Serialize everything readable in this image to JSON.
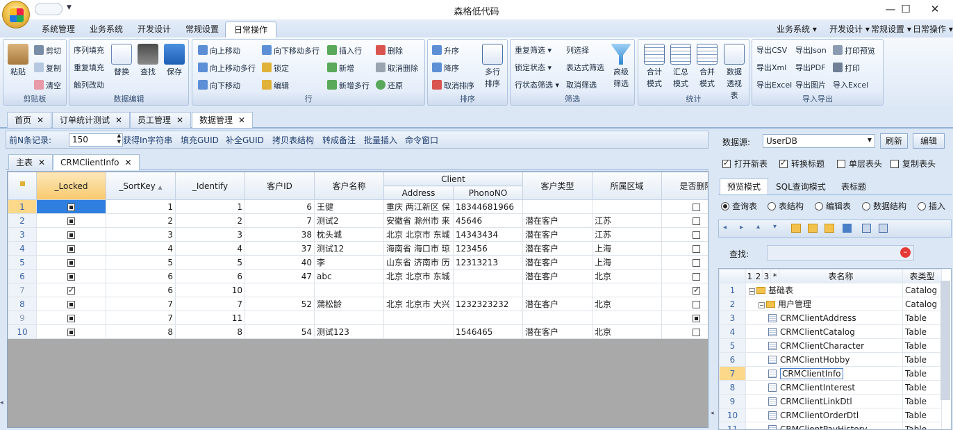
{
  "window": {
    "title": "森格低代码",
    "controls": [
      "—",
      "☐",
      "✕"
    ]
  },
  "ribbon_tabs": [
    "系统管理",
    "业务系统",
    "开发设计",
    "常规设置",
    "日常操作"
  ],
  "ribbon_menus": [
    "业务系统",
    "开发设计",
    "常规设置",
    "日常操作"
  ],
  "groups": {
    "clipboard": {
      "caption": "剪贴板",
      "paste": "粘贴",
      "cut": "剪切",
      "copy": "复制",
      "clear": "清空"
    },
    "dataedit": {
      "caption": "数据编辑",
      "seq_fill": "序列填充",
      "repeat_fill": "重复填充",
      "trigger_edit": "触列改动",
      "replace": "替换",
      "find": "查找",
      "save": "保存"
    },
    "row": {
      "caption": "行",
      "up": "向上移动",
      "up_multi": "向上移动多行",
      "down": "向下移动",
      "down_multi": "向下移动多行",
      "lock": "锁定",
      "edit": "编辑",
      "insert": "插入行",
      "new": "新增",
      "new_multi": "新增多行",
      "delete": "删除",
      "cancel_delete": "取消删除",
      "restore": "还原"
    },
    "sort": {
      "caption": "排序",
      "asc": "升序",
      "desc": "降序",
      "cancel": "取消排序",
      "multi": "多行排序"
    },
    "filter": {
      "caption": "筛选",
      "repeat": "重复筛选",
      "lock_state": "锁定状态",
      "row_state": "行状态筛选",
      "col_select": "列选择",
      "expr": "表达式筛选",
      "cancel": "取消筛选",
      "advanced": "高级筛选"
    },
    "stats": {
      "caption": "统计",
      "total": "合计模式",
      "summary": "汇总模式",
      "merge": "合并模式",
      "pivot": "数据透视表"
    },
    "io": {
      "caption": "导入导出",
      "csv": "导出CSV",
      "json": "导出Json",
      "print_preview": "打印预览",
      "xml": "导出Xml",
      "pdf": "导出PDF",
      "print": "打印",
      "excel": "导出Excel",
      "image": "导出图片",
      "import_excel": "导入Excel"
    }
  },
  "doc_tabs": [
    "首页",
    "订单统计测试",
    "员工管理",
    "数据管理"
  ],
  "toolbar": {
    "topn_label": "前N条记录:",
    "topn_value": "150",
    "links": [
      "获得In字符串",
      "填充GUID",
      "补全GUID",
      "拷贝表结构",
      "转成备注",
      "批量插入",
      "命令窗口"
    ]
  },
  "sub_tabs": [
    "主表",
    "CRMClientInfo"
  ],
  "grid": {
    "group_header": "Client",
    "headers": [
      "_Locked",
      "_SortKey",
      "_Identify",
      "客户ID",
      "客户名称",
      "Address",
      "PhonoNO",
      "客户类型",
      "所属区域",
      "是否删除"
    ],
    "rows": [
      {
        "n": "1",
        "locked": "fill",
        "sort": "1",
        "ident": "1",
        "id": "6",
        "name": "王健",
        "addr": "重庆 两江新区 保",
        "phone": "18344681966",
        "type": "",
        "region": "",
        "del": "box"
      },
      {
        "n": "2",
        "locked": "fill",
        "sort": "2",
        "ident": "2",
        "id": "7",
        "name": "测试2",
        "addr": "安徽省 滁州市 来",
        "phone": "45646",
        "type": "潜在客户",
        "region": "江苏",
        "del": "box"
      },
      {
        "n": "3",
        "locked": "fill",
        "sort": "3",
        "ident": "3",
        "id": "38",
        "name": "枕头城",
        "addr": "北京 北京市 东城",
        "phone": "14343434",
        "type": "潜在客户",
        "region": "江苏",
        "del": "box"
      },
      {
        "n": "4",
        "locked": "fill",
        "sort": "4",
        "ident": "4",
        "id": "37",
        "name": "测试12",
        "addr": "海南省 海口市 琼",
        "phone": "123456",
        "type": "潜在客户",
        "region": "上海",
        "del": "box"
      },
      {
        "n": "5",
        "locked": "fill",
        "sort": "5",
        "ident": "5",
        "id": "40",
        "name": "李",
        "addr": "山东省 济南市 历",
        "phone": "12313213",
        "type": "潜在客户",
        "region": "上海",
        "del": "box"
      },
      {
        "n": "6",
        "locked": "fill",
        "sort": "6",
        "ident": "6",
        "id": "47",
        "name": "abc",
        "addr": "北京 北京市 东城",
        "phone": "",
        "type": "潜在客户",
        "region": "北京",
        "del": "box"
      },
      {
        "n": "7",
        "locked": "tick",
        "sort": "6",
        "ident": "10",
        "id": "",
        "name": "",
        "addr": "",
        "phone": "",
        "type": "",
        "region": "",
        "del": "tick"
      },
      {
        "n": "8",
        "locked": "fill",
        "sort": "7",
        "ident": "7",
        "id": "52",
        "name": "蒲松龄",
        "addr": "北京 北京市 大兴",
        "phone": "1232323232",
        "type": "潜在客户",
        "region": "北京",
        "del": "box"
      },
      {
        "n": "9",
        "locked": "fill",
        "sort": "7",
        "ident": "11",
        "id": "",
        "name": "",
        "addr": "",
        "phone": "",
        "type": "",
        "region": "",
        "del": "fill"
      },
      {
        "n": "10",
        "locked": "fill",
        "sort": "8",
        "ident": "8",
        "id": "54",
        "name": "测试123",
        "addr": "",
        "phone": "1546465",
        "type": "潜在客户",
        "region": "北京",
        "del": "box"
      }
    ]
  },
  "right": {
    "datasource_label": "数据源:",
    "datasource_value": "UserDB",
    "refresh": "刷新",
    "edit": "编辑",
    "checks": [
      {
        "label": "打开新表",
        "on": true
      },
      {
        "label": "转换标题",
        "on": true
      },
      {
        "label": "单层表头",
        "on": false
      },
      {
        "label": "复制表头",
        "on": false
      }
    ],
    "tabs": [
      "预览模式",
      "SQL查询模式",
      "表标题"
    ],
    "radios": [
      {
        "label": "查询表",
        "on": true
      },
      {
        "label": "表结构",
        "on": false
      },
      {
        "label": "编辑表",
        "on": false
      },
      {
        "label": "数据结构",
        "on": false
      },
      {
        "label": "插入",
        "on": false
      }
    ],
    "find_label": "查找:",
    "tree_headers": [
      "1",
      "2",
      "3",
      "*",
      "表名称",
      "表类型"
    ],
    "tree_rows": [
      {
        "n": "1",
        "name": "基础表",
        "type": "Catalog",
        "level": 0,
        "kind": "folder"
      },
      {
        "n": "2",
        "name": "用户管理",
        "type": "Catalog",
        "level": 1,
        "kind": "folder"
      },
      {
        "n": "3",
        "name": "CRMClientAddress",
        "type": "Table",
        "level": 2,
        "kind": "table"
      },
      {
        "n": "4",
        "name": "CRMClientCatalog",
        "type": "Table",
        "level": 2,
        "kind": "table"
      },
      {
        "n": "5",
        "name": "CRMClientCharacter",
        "type": "Table",
        "level": 2,
        "kind": "table"
      },
      {
        "n": "6",
        "name": "CRMClientHobby",
        "type": "Table",
        "level": 2,
        "kind": "table"
      },
      {
        "n": "7",
        "name": "CRMClientInfo",
        "type": "Table",
        "level": 2,
        "kind": "table"
      },
      {
        "n": "8",
        "name": "CRMClientInterest",
        "type": "Table",
        "level": 2,
        "kind": "table"
      },
      {
        "n": "9",
        "name": "CRMClientLinkDtl",
        "type": "Table",
        "level": 2,
        "kind": "table"
      },
      {
        "n": "10",
        "name": "CRMClientOrderDtl",
        "type": "Table",
        "level": 2,
        "kind": "table"
      },
      {
        "n": "11",
        "name": "CRMClientPayHistory",
        "type": "Table",
        "level": 2,
        "kind": "table"
      }
    ]
  }
}
